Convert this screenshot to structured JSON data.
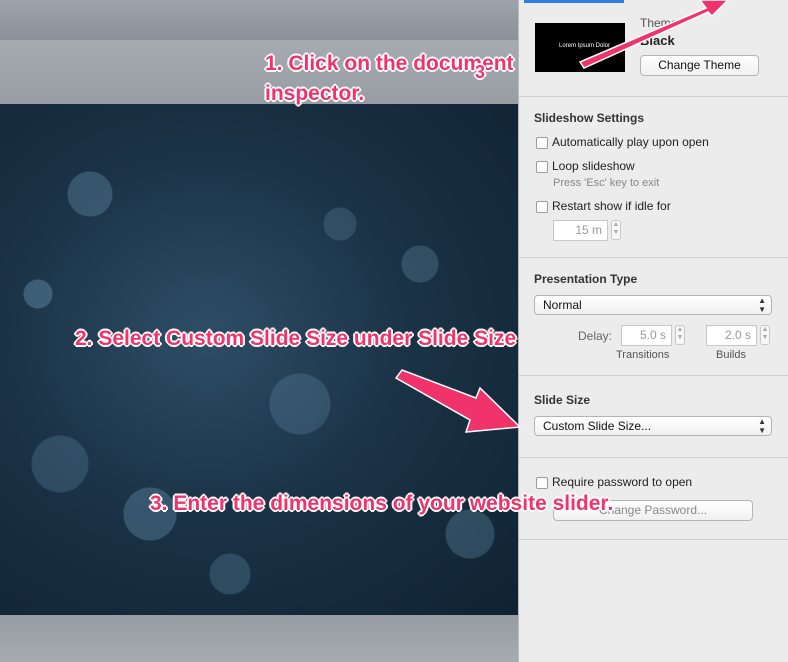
{
  "theme": {
    "label": "Theme",
    "name": "Black",
    "thumbnail_title": "Lorem Ipsum Dolor",
    "change_button": "Change Theme"
  },
  "slideshow_settings": {
    "heading": "Slideshow Settings",
    "autoplay": {
      "label": "Automatically play upon open",
      "checked": false
    },
    "loop": {
      "label": "Loop slideshow",
      "checked": false,
      "hint": "Press 'Esc' key to exit"
    },
    "restart": {
      "label": "Restart show if idle for",
      "checked": false,
      "value": "15 m"
    }
  },
  "presentation_type": {
    "heading": "Presentation Type",
    "selected": "Normal",
    "delay_label": "Delay:",
    "transitions_value": "5.0 s",
    "transitions_label": "Transitions",
    "builds_value": "2.0 s",
    "builds_label": "Builds"
  },
  "slide_size": {
    "heading": "Slide Size",
    "selected": "Custom Slide Size..."
  },
  "password": {
    "label": "Require password to open",
    "checked": false,
    "button": "Change Password..."
  },
  "annotations": {
    "step1_line1": "1. Click on the document",
    "step1_line2": "inspector.",
    "step1_marker": "3",
    "step2": "2. Select Custom Slide Size under Slide Size",
    "step3": "3. Enter the dimensions of your website slider.",
    "color": "#f0336b"
  },
  "colors": {
    "inspector_bg": "#ececec",
    "slide_dark": "#0f2231",
    "accent": "#2f7ee6"
  }
}
